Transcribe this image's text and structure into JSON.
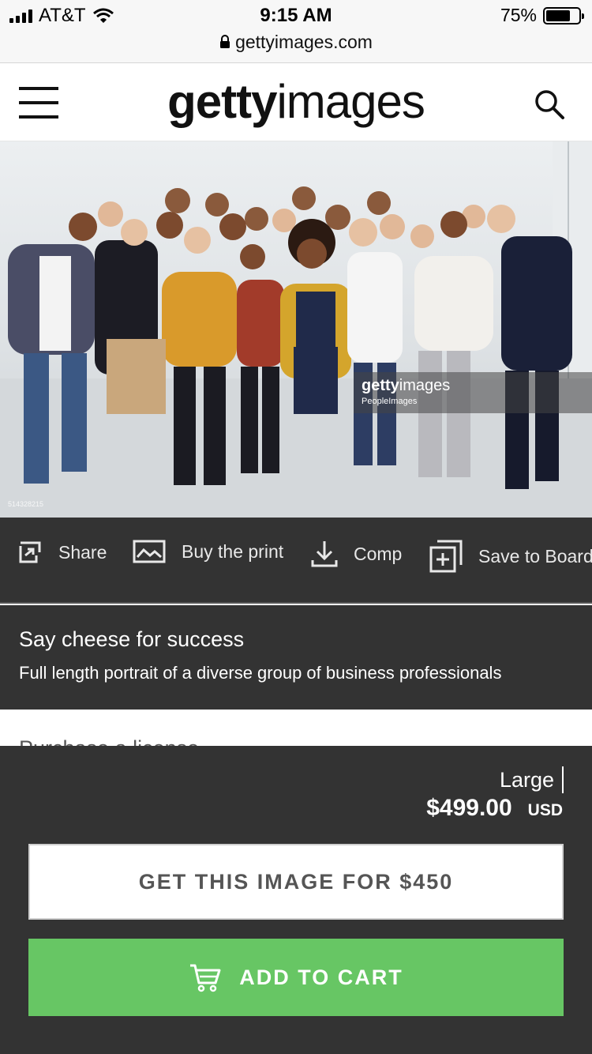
{
  "status_bar": {
    "carrier": "AT&T",
    "time": "9:15 AM",
    "battery_text": "75%",
    "battery_level": 0.75,
    "url": "gettyimages.com",
    "icons": [
      "signal-icon",
      "wifi-icon",
      "lock-icon",
      "battery-icon"
    ]
  },
  "header": {
    "logo_bold": "getty",
    "logo_light": "images",
    "icons": [
      "hamburger-menu-icon",
      "search-icon"
    ]
  },
  "hero": {
    "watermark_logo_bold": "getty",
    "watermark_logo_light": "images",
    "watermark_credit": "PeopleImages",
    "image_id": "514328215"
  },
  "actions": {
    "share": "Share",
    "buy_print": "Buy the print",
    "comp": "Comp",
    "save_board": "Save to Board",
    "icons": [
      "share-icon",
      "print-icon",
      "download-icon",
      "add-board-icon"
    ]
  },
  "description": {
    "title": "Say cheese for success",
    "caption": "Full length portrait of a diverse group of business professionals"
  },
  "license_peek": "Purchase a license",
  "purchase": {
    "size": "Large",
    "price": "$499.00",
    "currency": "USD",
    "get_image_label": "GET THIS IMAGE FOR $450",
    "add_to_cart_label": "ADD TO CART"
  },
  "colors": {
    "dark_panel": "#333333",
    "cart_green": "#67c664",
    "status_bar_bg": "#f7f7f7"
  }
}
